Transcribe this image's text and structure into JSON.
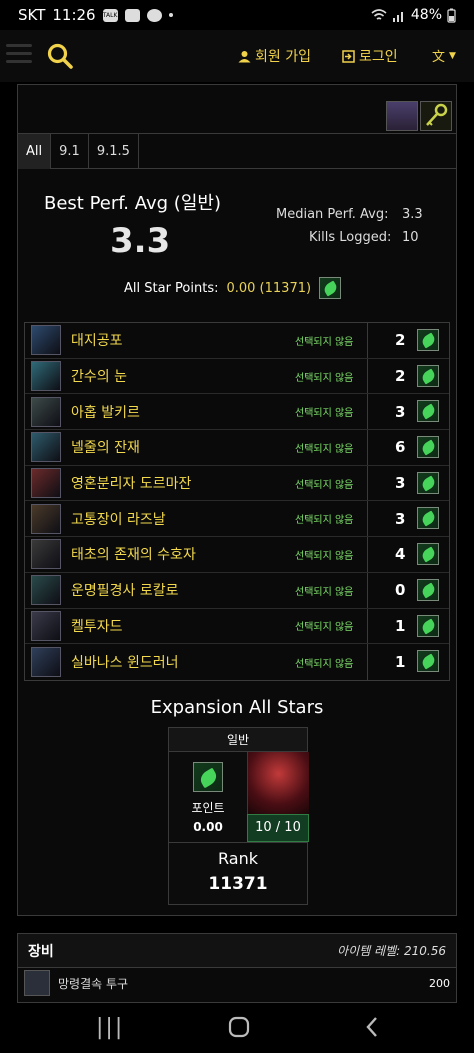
{
  "status_bar": {
    "carrier": "SKT",
    "time": "11:26",
    "talk": "TALK",
    "battery": "48%"
  },
  "nav": {
    "signup": "회원 가입",
    "login": "로그인"
  },
  "tabs": [
    "All",
    "9.1",
    "9.1.5"
  ],
  "summary": {
    "best_label": "Best Perf. Avg (일반)",
    "best_value": "3.3",
    "median_label": "Median Perf. Avg:",
    "median_value": "3.3",
    "kills_label": "Kills Logged:",
    "kills_value": "10",
    "allstar_label": "All Star Points:",
    "allstar_value": "0.00 (11371)"
  },
  "bosses": [
    {
      "name": "대지공포",
      "status": "선택되지 않음",
      "count": "2"
    },
    {
      "name": "간수의 눈",
      "status": "선택되지 않음",
      "count": "2"
    },
    {
      "name": "아홉 발키르",
      "status": "선택되지 않음",
      "count": "3"
    },
    {
      "name": "넬줄의 잔재",
      "status": "선택되지 않음",
      "count": "6"
    },
    {
      "name": "영혼분리자 도르마잔",
      "status": "선택되지 않음",
      "count": "3"
    },
    {
      "name": "고통장이 라즈날",
      "status": "선택되지 않음",
      "count": "3"
    },
    {
      "name": "태초의 존재의 수호자",
      "status": "선택되지 않음",
      "count": "4"
    },
    {
      "name": "운명필경사 로칼로",
      "status": "선택되지 않음",
      "count": "0"
    },
    {
      "name": "켈투자드",
      "status": "선택되지 않음",
      "count": "1"
    },
    {
      "name": "실바나스 윈드러너",
      "status": "선택되지 않음",
      "count": "1"
    }
  ],
  "expansion": {
    "title": "Expansion All Stars",
    "difficulty": "일반",
    "points_label": "포인트",
    "points_value": "0.00",
    "ratio": "10 / 10",
    "rank_label": "Rank",
    "rank_value": "11371"
  },
  "gear": {
    "title": "장비",
    "item_level": "아이템 레벨: 210.56",
    "first_item": {
      "name": "망령결속 투구",
      "ilvl": "200"
    }
  },
  "colors": {
    "accent": "#f0d24b",
    "status_green": "#7ee06a",
    "allstar_green": "#46d45a"
  }
}
